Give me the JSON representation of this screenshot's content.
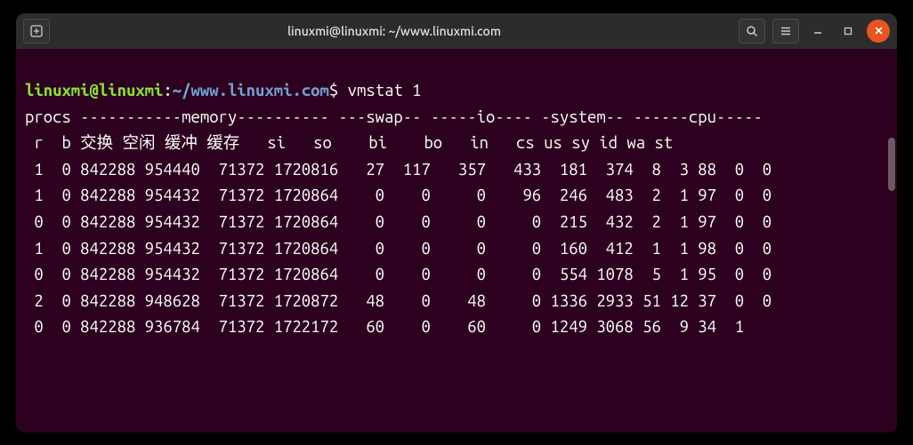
{
  "titlebar": {
    "title": "linuxmi@linuxmi: ~/www.linuxmi.com"
  },
  "prompt": {
    "user_host": "linuxmi@linuxmi",
    "path": "~/www.linuxmi.com",
    "command": "vmstat 1"
  },
  "output": {
    "header1": "procs -----------memory---------- ---swap-- -----io---- -system-- ------cpu-----",
    "header2": " r  b 交换 空闲 缓冲 缓存   si   so    bi    bo   in   cs us sy id wa st",
    "rows": [
      " 1  0 842288 954440  71372 1720816   27  117   357   433  181  374  8  3 88  0  0",
      " 1  0 842288 954432  71372 1720864    0    0     0    96  246  483  2  1 97  0  0",
      " 0  0 842288 954432  71372 1720864    0    0     0     0  215  432  2  1 97  0  0",
      " 1  0 842288 954432  71372 1720864    0    0     0     0  160  412  1  1 98  0  0",
      " 0  0 842288 954432  71372 1720864    0    0     0     0  554 1078  5  1 95  0  0",
      " 2  0 842288 948628  71372 1720872   48    0    48     0 1336 2933 51 12 37  0  0",
      " 0  0 842288 936784  71372 1722172   60    0    60     0 1249 3068 56  9 34  1"
    ]
  }
}
